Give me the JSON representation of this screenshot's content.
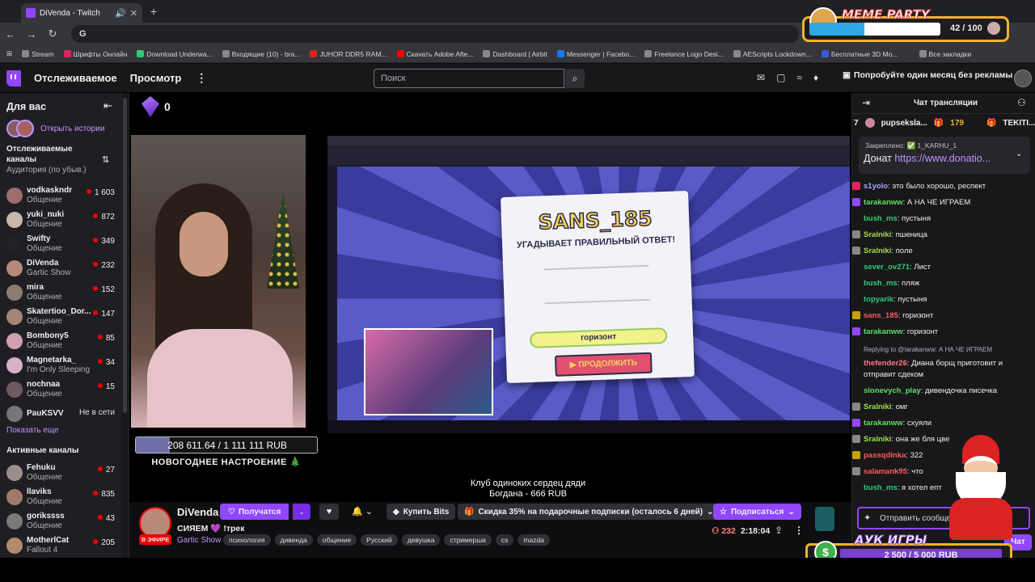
{
  "browser": {
    "tab_title": "DiVenda - Twitch",
    "url": "G",
    "bookmarks": [
      "Stream",
      "Шрифты Онлайн",
      "Download Underwa...",
      "Входящие (10) - bra...",
      "JUHOR DDR5 RAM...",
      "Скачать Adobe Afte...",
      "Dashboard | Airbit",
      "Messenger | Facebo...",
      "Freelance Logo Desi...",
      "AEScripts Lockdown...",
      "Бесплатные 3D Мо...",
      "Все закладки"
    ]
  },
  "topbar": {
    "following": "Отслеживаемое",
    "browse": "Просмотр",
    "search_placeholder": "Поиск",
    "promo": "Попробуйте один месяц без рекламы"
  },
  "sidebar": {
    "header": "Для вас",
    "stories": "Открыть истории",
    "followed_header": "Отслеживаемые каналы",
    "followed_sub": "Аудитория (по убыв.)",
    "followed": [
      {
        "name": "vodkaskndr",
        "category": "Общение",
        "viewers": "1 603"
      },
      {
        "name": "yuki_nuki",
        "category": "Общение",
        "viewers": "872"
      },
      {
        "name": "Swifty",
        "category": "Общение",
        "viewers": "349"
      },
      {
        "name": "DiVenda",
        "category": "Gartic Show",
        "viewers": "232"
      },
      {
        "name": "mira",
        "category": "Общение",
        "viewers": "152"
      },
      {
        "name": "Skatertioo_Dor...",
        "category": "Общение",
        "viewers": "147"
      },
      {
        "name": "Bombony5",
        "category": "Общение",
        "viewers": "85"
      },
      {
        "name": "Magnetarka_",
        "category": "I'm Only Sleeping",
        "viewers": "34"
      },
      {
        "name": "nochnaa",
        "category": "Общение",
        "viewers": "15"
      }
    ],
    "offline": {
      "name": "PauKSVV",
      "status": "Не в сети"
    },
    "show_more": "Показать еще",
    "active_header": "Активные каналы",
    "active": [
      {
        "name": "Fehuku",
        "category": "Общение",
        "viewers": "27"
      },
      {
        "name": "llaviks",
        "category": "Общение",
        "viewers": "835"
      },
      {
        "name": "gorikssss",
        "category": "Общение",
        "viewers": "43"
      },
      {
        "name": "MotherlCat",
        "category": "Fallout 4",
        "viewers": "205"
      }
    ]
  },
  "player": {
    "bits_count": "0",
    "goal_text": "208 611.64 / 1 111 111 RUB",
    "goal_progress": 0.1878,
    "goal_label": "НОВОГОДНЕЕ НАСТРОЕНИЕ 🎄",
    "game_name": "SANS_185",
    "game_message": "УГАДЫВАЕТ ПРАВИЛЬНЫЙ ОТВЕТ!",
    "game_answer": "горизонт",
    "game_continue": "▶ ПРОДОЛЖИТЬ",
    "caption_line1": "Клуб одиноких сердец дяди",
    "caption_line2": "Богдана - 666 RUB"
  },
  "info": {
    "channel": "DiVenda",
    "live": "В ЭФИРЕ",
    "follow": "Получатся",
    "bits": "Купить Bits",
    "gift": "Скидка 35% на подарочные подписки (осталось 6 дней)",
    "subscribe": "Подписаться",
    "title": "СИЯЕМ 💜 !трек",
    "game": "Gartic Show",
    "tags": [
      "психология",
      "дивенда",
      "общение",
      "Русский",
      "девушка",
      "стримерша",
      "cs",
      "mazda"
    ],
    "viewers": "232",
    "uptime": "2:18:04"
  },
  "chat": {
    "header": "Чат трансляции",
    "leader1": {
      "name": "pupseksla...",
      "count": "179"
    },
    "leader2": {
      "name": "TEKITI..."
    },
    "leader_rank": "7",
    "pinned_by": "Закреплено: ✅ 1_KARHU_1",
    "pinned_text_prefix": "Донат ",
    "pinned_link": "https://www.donatio...",
    "messages": [
      {
        "user": "s1yolo",
        "color": "#a8a8ff",
        "text": "это было хорошо, респект",
        "badge": "#e0245e"
      },
      {
        "user": "tarakanww",
        "color": "#5ee05e",
        "text": "А НА ЧЕ ИГРАЕМ",
        "badge": "#9147ff"
      },
      {
        "user": "bush_ms",
        "color": "#2ecc71",
        "text": "пустыня",
        "badge": ""
      },
      {
        "user": "Sralniki",
        "color": "#9fdc4a",
        "text": "пшеница",
        "badge": "#888"
      },
      {
        "user": "Sralniki",
        "color": "#9fdc4a",
        "text": "поле",
        "badge": "#888"
      },
      {
        "user": "sever_ov271",
        "color": "#2ecc71",
        "text": "Лист",
        "badge": ""
      },
      {
        "user": "bush_ms",
        "color": "#2ecc71",
        "text": "пляж",
        "badge": ""
      },
      {
        "user": "topyarik",
        "color": "#2ecc71",
        "text": "пустыня",
        "badge": ""
      },
      {
        "user": "sans_185",
        "color": "#ff5a5a",
        "text": "горизонт",
        "badge": "#c8a000"
      },
      {
        "user": "tarakanww",
        "color": "#5ee05e",
        "text": "горизонт",
        "badge": "#9147ff"
      }
    ],
    "reply_note": "Replying to @tarakanww: А НА ЧЕ ИГРАЕМ",
    "messages2": [
      {
        "user": "thefender26",
        "color": "#ff7b7b",
        "text": "Диана борщ приготовит и отправит сдеком",
        "badge": ""
      },
      {
        "user": "slonevych_play",
        "color": "#5ee05e",
        "text": "дивендочка писечка",
        "badge": ""
      },
      {
        "user": "Sralniki",
        "color": "#9fdc4a",
        "text": "омг",
        "badge": "#888"
      },
      {
        "user": "tarakanww",
        "color": "#5ee05e",
        "text": "схуяли",
        "badge": "#9147ff"
      },
      {
        "user": "Sralniki",
        "color": "#9fdc4a",
        "text": "она же бля цве",
        "badge": "#888"
      },
      {
        "user": "passqdinka",
        "color": "#ff5a5a",
        "text": "322",
        "badge": "#c8a000"
      },
      {
        "user": "salamank95",
        "color": "#ff5a5a",
        "text": "что",
        "badge": "#888"
      },
      {
        "user": "bush_ms",
        "color": "#2ecc71",
        "text": "я хотел епт",
        "badge": ""
      }
    ],
    "input_placeholder": "Отправить сообщение",
    "send": "Чат"
  },
  "overlays": {
    "meme_title": "MEME PARTY",
    "meme_count": "42 / 100",
    "meme_progress": 0.42,
    "auk_title": "АУК ИГРЫ",
    "auk_amount": "2 500 / 5 000 RUB"
  }
}
